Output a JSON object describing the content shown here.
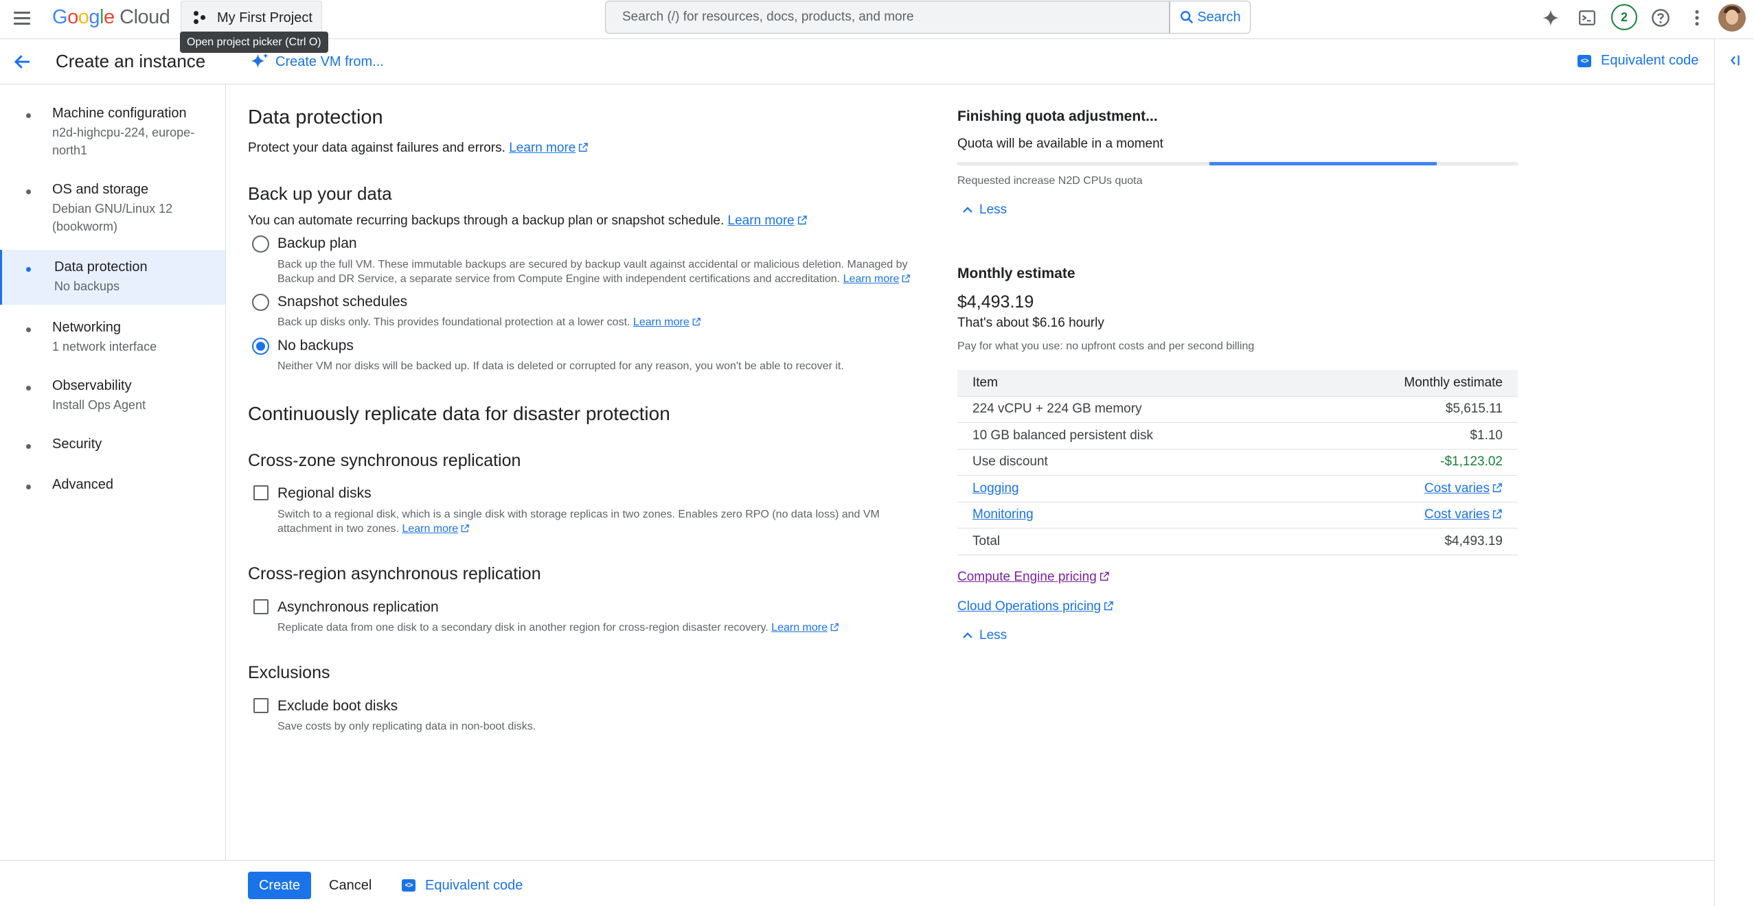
{
  "topbar": {
    "logo_google": "Google",
    "logo_cloud": "Cloud",
    "project_name": "My First Project",
    "project_tooltip": "Open project picker (Ctrl O)",
    "search_placeholder": "Search (/) for resources, docs, products, and more",
    "search_button": "Search",
    "notification_count": "2",
    "icons": [
      "menu-icon",
      "sparkle-icon",
      "terminal-icon",
      "help-icon",
      "more-vert-icon",
      "avatar"
    ]
  },
  "subheader": {
    "title": "Create an instance",
    "create_vm_from": "Create VM from...",
    "equivalent_code": "Equivalent code"
  },
  "nav": {
    "items": [
      {
        "label": "Machine configuration",
        "sub1": "n2d-highcpu-224, europe-",
        "sub2": "north1"
      },
      {
        "label": "OS and storage",
        "sub1": "Debian GNU/Linux 12",
        "sub2": "(bookworm)"
      },
      {
        "label": "Data protection",
        "sub1": "No backups",
        "active": true
      },
      {
        "label": "Networking",
        "sub1": "1 network interface"
      },
      {
        "label": "Observability",
        "sub1": "Install Ops Agent"
      },
      {
        "label": "Security"
      },
      {
        "label": "Advanced"
      }
    ]
  },
  "main": {
    "title": "Data protection",
    "intro": "Protect your data against failures and errors.",
    "learn_more": "Learn more",
    "backup_title": "Back up your data",
    "backup_intro": "You can automate recurring backups through a backup plan or snapshot schedule.",
    "options": [
      {
        "label": "Backup plan",
        "desc1": "Back up the full VM. These immutable backups are secured by backup vault against accidental or malicious deletion. Managed by",
        "desc2": "Backup and DR Service, a separate service from Compute Engine with independent certifications and accreditation.",
        "checked": false
      },
      {
        "label": "Snapshot schedules",
        "desc1": "Back up disks only. This provides foundational protection at a lower cost.",
        "checked": false
      },
      {
        "label": "No backups",
        "desc1": "Neither VM nor disks will be backed up. If data is deleted or corrupted for any reason, you won't be able to recover it.",
        "checked": true
      }
    ],
    "replicate_title": "Continuously replicate data for disaster protection",
    "crosszone_title": "Cross-zone synchronous replication",
    "regional_label": "Regional disks",
    "regional_desc1": "Switch to a regional disk, which is a single disk with storage replicas in two zones. Enables zero RPO (no data loss) and VM",
    "regional_desc2": "attachment in two zones.",
    "crossregion_title": "Cross-region asynchronous replication",
    "async_label": "Asynchronous replication",
    "async_desc": "Replicate data from one disk to a secondary disk in another region for cross-region disaster recovery.",
    "exclusions_title": "Exclusions",
    "exclude_label": "Exclude boot disks",
    "exclude_desc": "Save costs by only replicating data in non-boot disks."
  },
  "quota": {
    "title": "Finishing quota adjustment...",
    "subtitle": "Quota will be available in a moment",
    "progress_start": 0.45,
    "progress_end": 0.855,
    "requested": "Requested increase N2D CPUs quota",
    "less": "Less"
  },
  "estimate": {
    "title": "Monthly estimate",
    "amount": "$4,493.19",
    "hourly": "That's about $6.16 hourly",
    "note": "Pay for what you use: no upfront costs and per second billing",
    "col_item": "Item",
    "col_estimate": "Monthly estimate",
    "rows": [
      {
        "item": "224 vCPU + 224 GB memory",
        "value": "$5,615.11"
      },
      {
        "item": "10 GB balanced persistent disk",
        "value": "$1.10"
      },
      {
        "item": "Use discount",
        "value": "-$1,123.02"
      },
      {
        "item": "Logging",
        "value": "Cost varies"
      },
      {
        "item": "Monitoring",
        "value": "Cost varies"
      },
      {
        "item": "Total",
        "value": "$4,493.19"
      }
    ],
    "link_compute": "Compute Engine pricing",
    "link_ops": "Cloud Operations pricing",
    "less": "Less"
  },
  "footer": {
    "create": "Create",
    "cancel": "Cancel",
    "equivalent_code": "Equivalent code"
  }
}
